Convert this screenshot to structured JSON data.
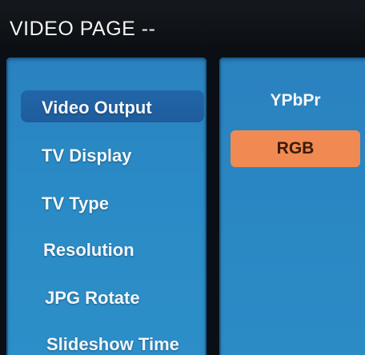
{
  "header": {
    "title": "VIDEO PAGE --"
  },
  "menu": {
    "items": [
      {
        "label": "Video Output",
        "selected": true
      },
      {
        "label": "TV Display",
        "selected": false
      },
      {
        "label": "TV Type",
        "selected": false
      },
      {
        "label": "Resolution",
        "selected": false
      },
      {
        "label": "JPG Rotate",
        "selected": false
      },
      {
        "label": "Slideshow Time",
        "selected": false
      }
    ]
  },
  "options": {
    "items": [
      {
        "label": "YPbPr",
        "highlighted": false
      },
      {
        "label": "RGB",
        "highlighted": true
      }
    ]
  },
  "colors": {
    "panel_blue": "#2a8ac5",
    "selected_item": "#2266a8",
    "highlight_orange": "#f08a52",
    "title_bar": "#0b0e12"
  }
}
